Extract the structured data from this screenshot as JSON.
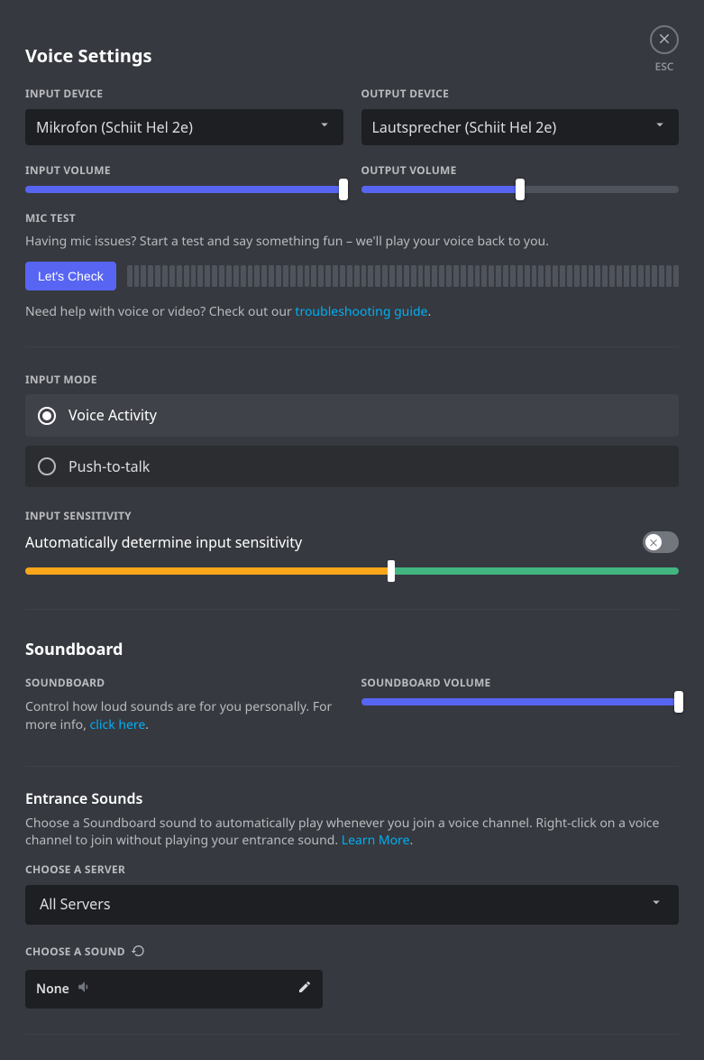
{
  "header": {
    "title": "Voice Settings",
    "esc": "ESC"
  },
  "inputDevice": {
    "label": "Input Device",
    "value": "Mikrofon (Schiit Hel 2e)"
  },
  "outputDevice": {
    "label": "Output Device",
    "value": "Lautsprecher (Schiit Hel 2e)"
  },
  "inputVolume": {
    "label": "Input Volume",
    "percent": 100
  },
  "outputVolume": {
    "label": "Output Volume",
    "percent": 50
  },
  "micTest": {
    "label": "Mic Test",
    "desc": "Having mic issues? Start a test and say something fun – we'll play your voice back to you.",
    "button": "Let's Check",
    "helpPrefix": "Need help with voice or video? Check out our ",
    "helpLink": "troubleshooting guide",
    "helpSuffix": "."
  },
  "inputMode": {
    "label": "Input Mode",
    "options": [
      "Voice Activity",
      "Push-to-talk"
    ],
    "selectedIndex": 0
  },
  "inputSensitivity": {
    "label": "Input Sensitivity",
    "toggleLabel": "Automatically determine input sensitivity",
    "enabled": false,
    "thresholdPercent": 56
  },
  "soundboard": {
    "title": "Soundboard",
    "label": "Soundboard",
    "descPrefix": "Control how loud sounds are for you personally. For more info, ",
    "descLink": "click here",
    "descSuffix": ".",
    "volumeLabel": "Soundboard Volume",
    "volumePercent": 100
  },
  "entrance": {
    "title": "Entrance Sounds",
    "descPrefix": "Choose a Soundboard sound to automatically play whenever you join a voice channel. Right-click on a voice channel to join without playing your entrance sound. ",
    "descLink": "Learn More",
    "descSuffix": ".",
    "serverLabel": "Choose a Server",
    "serverValue": "All Servers",
    "soundLabel": "Choose a Sound",
    "soundValue": "None"
  }
}
